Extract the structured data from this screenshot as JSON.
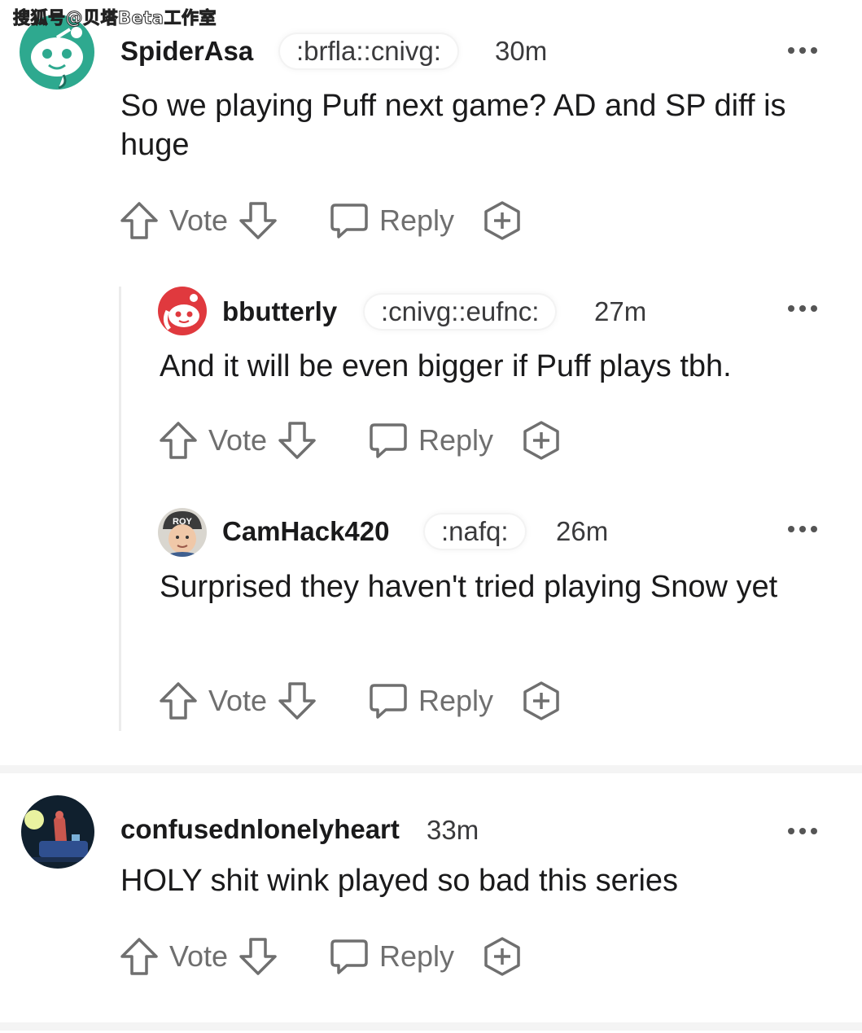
{
  "watermark": "搜狐号@贝塔Beta工作室",
  "comments": [
    {
      "username": "SpiderAsa",
      "flair": ":brfla::cnivg:",
      "time": "30m",
      "body": "So we playing Puff next game? AD and SP diff is huge",
      "vote_label": "Vote",
      "reply_label": "Reply"
    },
    {
      "username": "bbutterly",
      "flair": ":cnivg::eufnc:",
      "time": "27m",
      "body": "And it will be even bigger if Puff plays tbh.",
      "vote_label": "Vote",
      "reply_label": "Reply"
    },
    {
      "username": "CamHack420",
      "flair": ":nafq:",
      "time": "26m",
      "body": "Surprised they haven't tried playing Snow yet",
      "vote_label": "Vote",
      "reply_label": "Reply",
      "avatar_text": "ROY"
    },
    {
      "username": "confusednlonelyheart",
      "time": "33m",
      "body": "HOLY shit wink played so bad this series",
      "vote_label": "Vote",
      "reply_label": "Reply"
    }
  ],
  "icons": {
    "upvote": "arrow-up-icon",
    "downvote": "arrow-down-icon",
    "reply": "speech-bubble-icon",
    "award": "award-plus-icon",
    "more": "more-dots-icon"
  },
  "colors": {
    "teal_avatar": "#2ea98f",
    "red_avatar": "#e0393e",
    "text": "#1a1a1b",
    "muted": "#6f6f6f"
  }
}
